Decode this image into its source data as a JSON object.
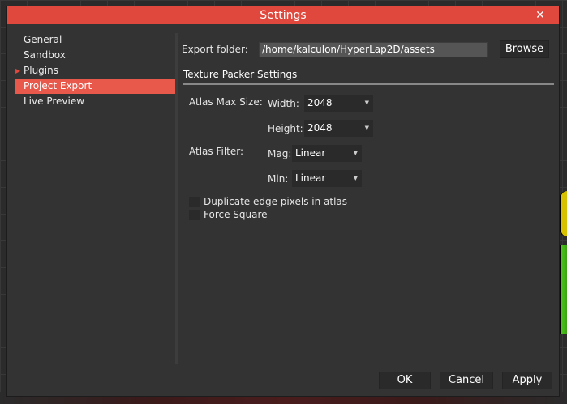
{
  "dialog": {
    "title": "Settings",
    "close_glyph": "✕"
  },
  "sidebar": {
    "items": [
      {
        "label": "General"
      },
      {
        "label": "Sandbox"
      },
      {
        "label": "Plugins",
        "marker": "▶"
      },
      {
        "label": "Project Export",
        "selected": true
      },
      {
        "label": "Live Preview"
      }
    ]
  },
  "export": {
    "label": "Export folder:",
    "path": "/home/kalculon/HyperLap2D/assets",
    "browse_label": "Browse"
  },
  "texture_packer": {
    "title": "Texture Packer Settings",
    "atlas_max_size_label": "Atlas Max Size:",
    "width_label": "Width:",
    "width_value": "2048",
    "height_label": "Height:",
    "height_value": "2048",
    "atlas_filter_label": "Atlas Filter:",
    "mag_label": "Mag:",
    "mag_value": "Linear",
    "min_label": "Min:",
    "min_value": "Linear",
    "duplicate_edge_label": "Duplicate edge pixels in atlas",
    "duplicate_edge_checked": false,
    "force_square_label": "Force Square",
    "force_square_checked": false
  },
  "footer": {
    "ok_label": "OK",
    "cancel_label": "Cancel",
    "apply_label": "Apply"
  },
  "icons": {
    "dropdown": "▼",
    "close": "close-icon",
    "expand": "triangle-right-icon"
  },
  "colors": {
    "accent": "#e0473d",
    "selected": "#e8584b",
    "panel": "#333333"
  }
}
